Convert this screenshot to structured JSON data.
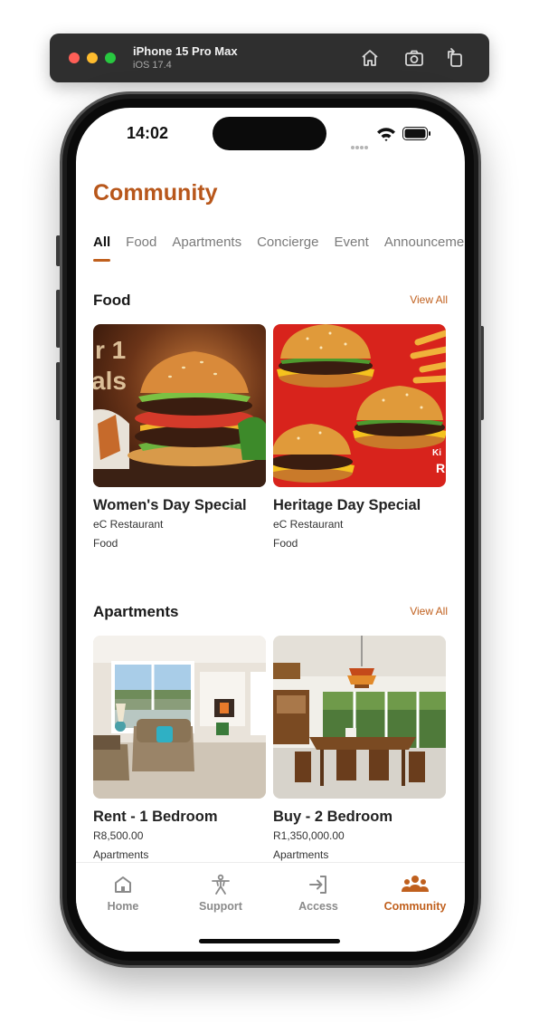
{
  "simulator": {
    "title": "iPhone 15 Pro Max",
    "subtitle": "iOS 17.4",
    "icons": [
      "home-icon",
      "screenshot-icon",
      "rotate-icon"
    ]
  },
  "status_bar": {
    "time": "14:02"
  },
  "header": {
    "title": "Community"
  },
  "tabs": [
    {
      "label": "All",
      "active": true
    },
    {
      "label": "Food"
    },
    {
      "label": "Apartments"
    },
    {
      "label": "Concierge"
    },
    {
      "label": "Event"
    },
    {
      "label": "Announceme"
    }
  ],
  "sections": {
    "food": {
      "title": "Food",
      "view_all": "View All",
      "cards": [
        {
          "title": "Women's Day Special",
          "subtitle": "eC Restaurant",
          "category": "Food"
        },
        {
          "title": "Heritage Day Special",
          "subtitle": "eC Restaurant",
          "category": "Food"
        }
      ]
    },
    "apartments": {
      "title": "Apartments",
      "view_all": "View All",
      "cards": [
        {
          "title": "Rent - 1 Bedroom",
          "subtitle": "R8,500.00",
          "category": "Apartments"
        },
        {
          "title": "Buy - 2 Bedroom",
          "subtitle": "R1,350,000.00",
          "category": "Apartments"
        }
      ]
    }
  },
  "tabbar": [
    {
      "label": "Home",
      "icon": "home-icon"
    },
    {
      "label": "Support",
      "icon": "support-icon"
    },
    {
      "label": "Access",
      "icon": "access-icon"
    },
    {
      "label": "Community",
      "icon": "community-icon",
      "active": true
    }
  ],
  "colors": {
    "accent": "#c0601e",
    "title": "#b8571b",
    "inactive": "#8a8a8a"
  }
}
